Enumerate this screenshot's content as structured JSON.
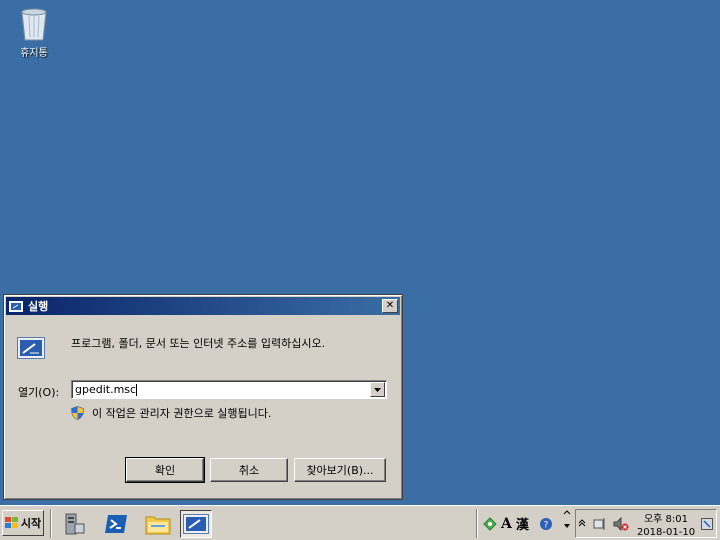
{
  "desktop": {
    "recycle_bin_label": "휴지통"
  },
  "run_dialog": {
    "title": "실행",
    "prompt": "프로그램, 폴더, 문서 또는 인터넷 주소를 입력하십시오.",
    "open_label": "열기(O):",
    "open_value": "gpedit.msc",
    "admin_note": "이 작업은 관리자 권한으로 실행됩니다.",
    "ok_label": "확인",
    "cancel_label": "취소",
    "browse_label": "찾아보기(B)...",
    "close_glyph": "✕"
  },
  "taskbar": {
    "start_label": "시작",
    "pinned": [
      "server-manager-icon",
      "powershell-icon",
      "explorer-folder-icon",
      "run-icon"
    ],
    "lang_a": "A",
    "lang_han": "漢",
    "clock_time": "오후 8:01",
    "clock_date": "2018-01-10"
  },
  "colors": {
    "desktop": "#3a6ea5",
    "titlebar": "#0a246a",
    "face": "#d4d0c8"
  }
}
